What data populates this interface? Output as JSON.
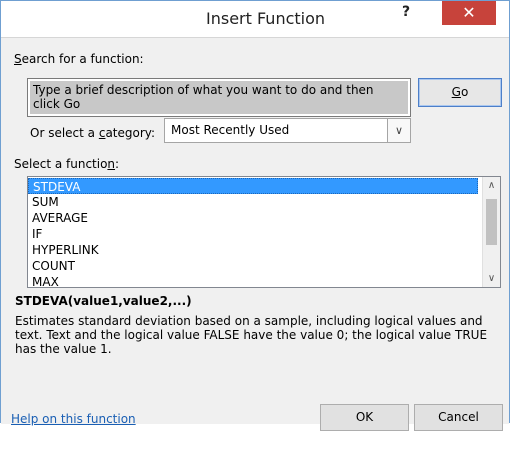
{
  "window": {
    "title": "Insert Function",
    "help_glyph": "?",
    "close_glyph": "✕"
  },
  "search": {
    "label_prefix": "",
    "label_key": "S",
    "label_rest": "earch for a function:",
    "value": "Type a brief description of what you want to do and then click Go",
    "go_key": "G",
    "go_rest": "o"
  },
  "category": {
    "label_prefix": "Or select a ",
    "label_key": "c",
    "label_rest": "ategory:",
    "selected": "Most Recently Used",
    "dropdown_glyph": "∨"
  },
  "functions": {
    "label_prefix": "Select a functio",
    "label_key": "n",
    "label_rest": ":",
    "items": [
      "STDEVA",
      "SUM",
      "AVERAGE",
      "IF",
      "HYPERLINK",
      "COUNT",
      "MAX"
    ],
    "selected_index": 0
  },
  "details": {
    "signature": "STDEVA(value1,value2,...)",
    "description": "Estimates standard deviation based on a sample, including logical values and text. Text and the logical value FALSE have the value 0; the logical value TRUE has the value 1."
  },
  "footer": {
    "help_link": "Help on this function",
    "ok": "OK",
    "cancel": "Cancel"
  },
  "colors": {
    "selection": "#3399ff",
    "close": "#c7433b",
    "link": "#1a5fb4"
  }
}
